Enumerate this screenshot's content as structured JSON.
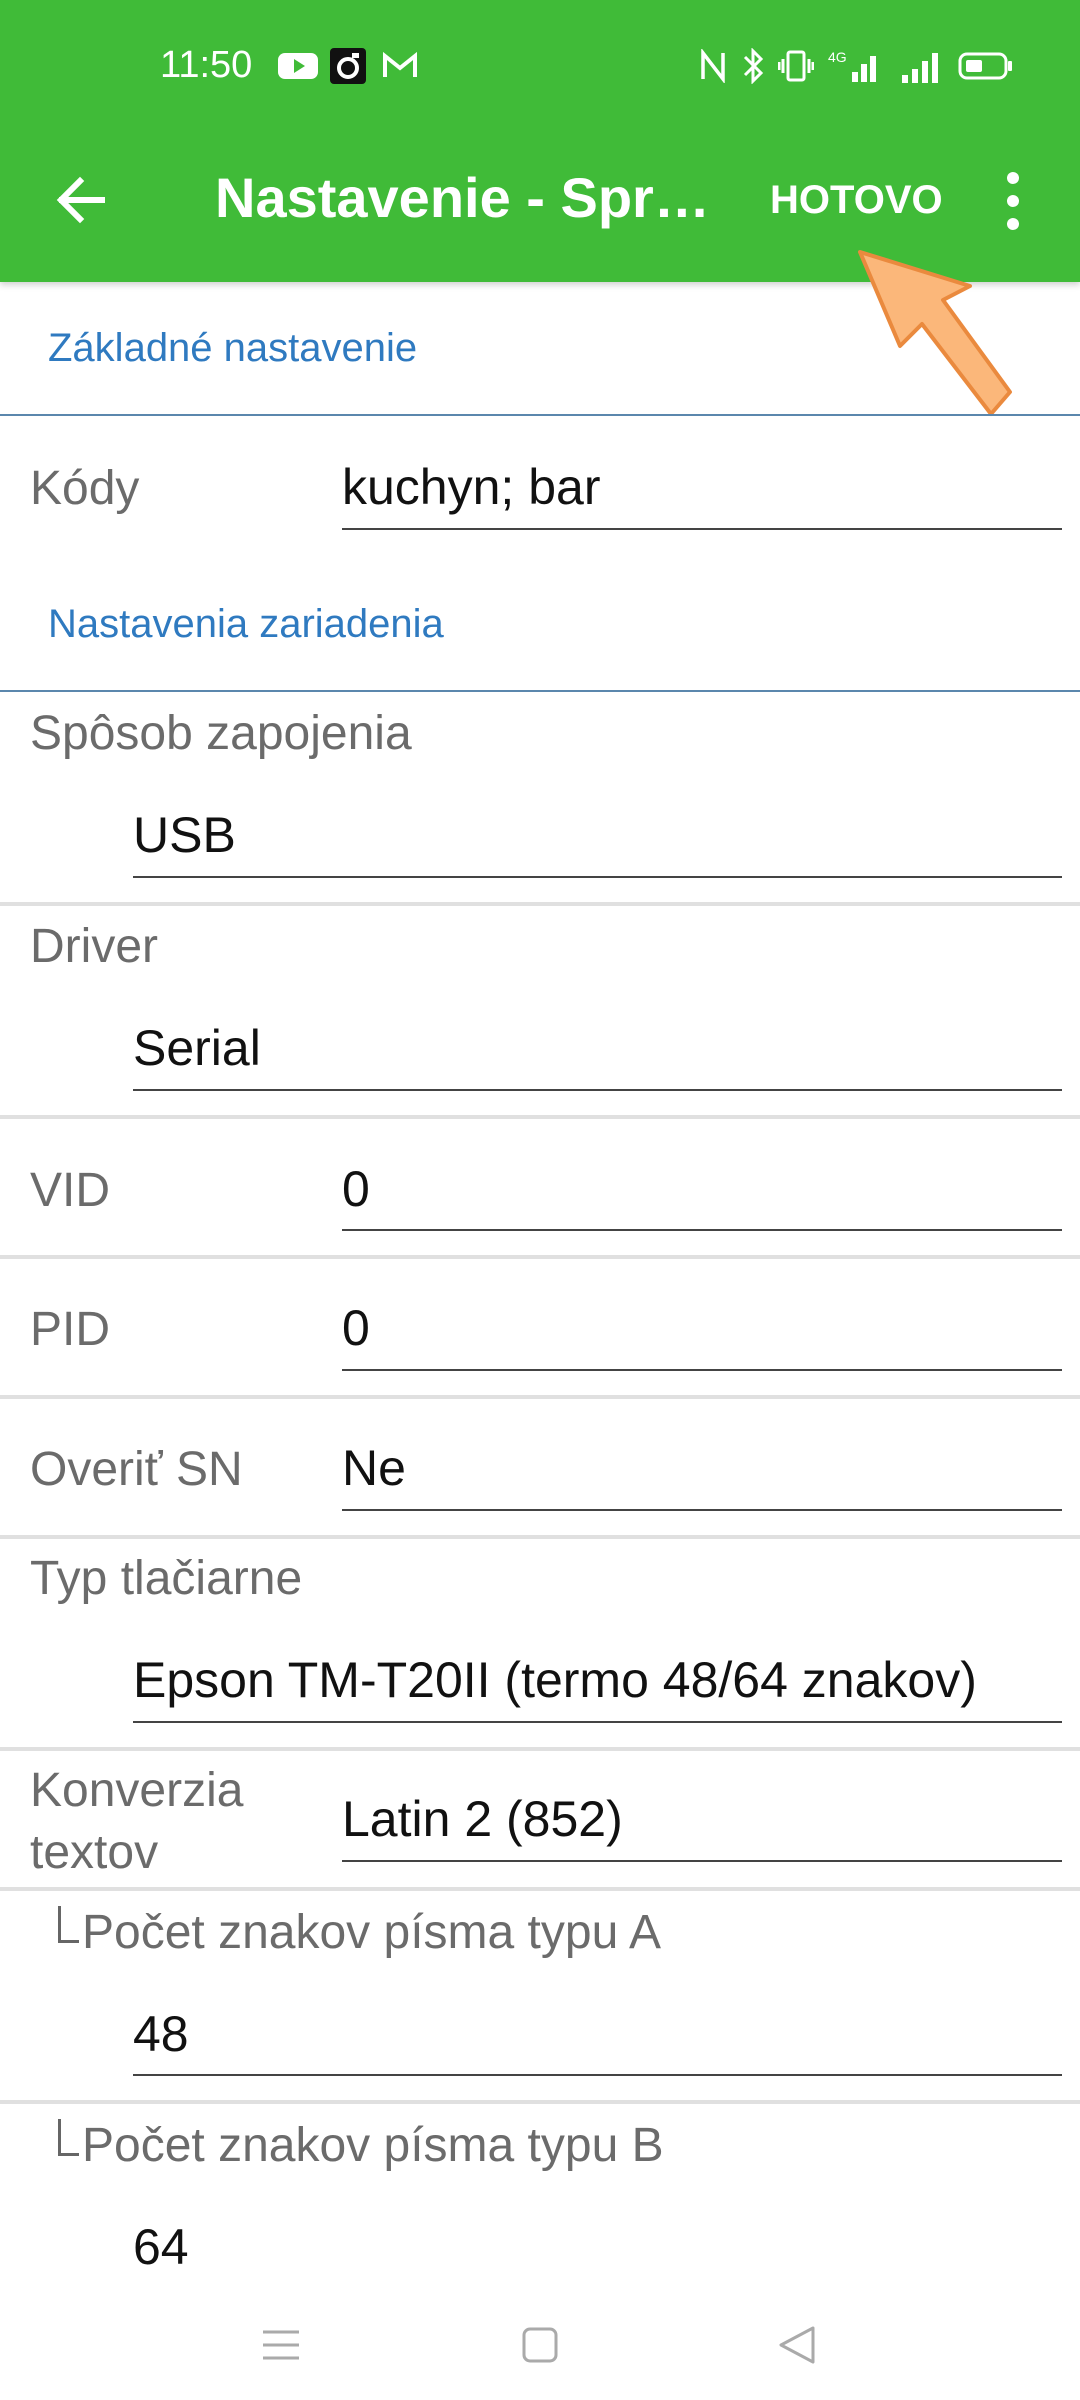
{
  "status_bar": {
    "time": "11:50",
    "left_icons": [
      "youtube-icon",
      "camera-icon",
      "gmail-icon"
    ],
    "right_icons": [
      "nfc-icon",
      "bluetooth-icon",
      "vibrate-icon",
      "4g-signal-icon",
      "signal-icon",
      "battery-icon"
    ]
  },
  "toolbar": {
    "title": "Nastavenie - Spr…",
    "done_label": "HOTOVO",
    "back_icon": "arrow-back-icon",
    "more_icon": "more-vert-icon"
  },
  "sections": {
    "basic": "Základné nastavenie",
    "device": "Nastavenia zariadenia"
  },
  "fields": {
    "kody": {
      "label": "Kódy",
      "value": "kuchyn; bar"
    },
    "sposob": {
      "label": "Spôsob zapojenia",
      "value": "USB"
    },
    "driver": {
      "label": "Driver",
      "value": "Serial"
    },
    "vid": {
      "label": "VID",
      "value": "0"
    },
    "pid": {
      "label": "PID",
      "value": "0"
    },
    "overit": {
      "label": "Overiť SN",
      "value": "Ne"
    },
    "typ": {
      "label": "Typ tlačiarne",
      "value": "Epson TM-T20II (termo 48/64 znakov)"
    },
    "konverzia": {
      "label": "Konverzia textov",
      "value": "Latin 2 (852)"
    },
    "pocet_a": {
      "label": "Počet znakov písma typu A",
      "value": "48"
    },
    "pocet_b": {
      "label": "Počet znakov písma typu B",
      "value": "64"
    }
  },
  "nav_bar": [
    "menu-icon",
    "home-square-icon",
    "back-triangle-icon"
  ],
  "colors": {
    "appbar": "#40bb38",
    "section_text": "#2f7ac0",
    "arrow": "#fbb77a"
  }
}
